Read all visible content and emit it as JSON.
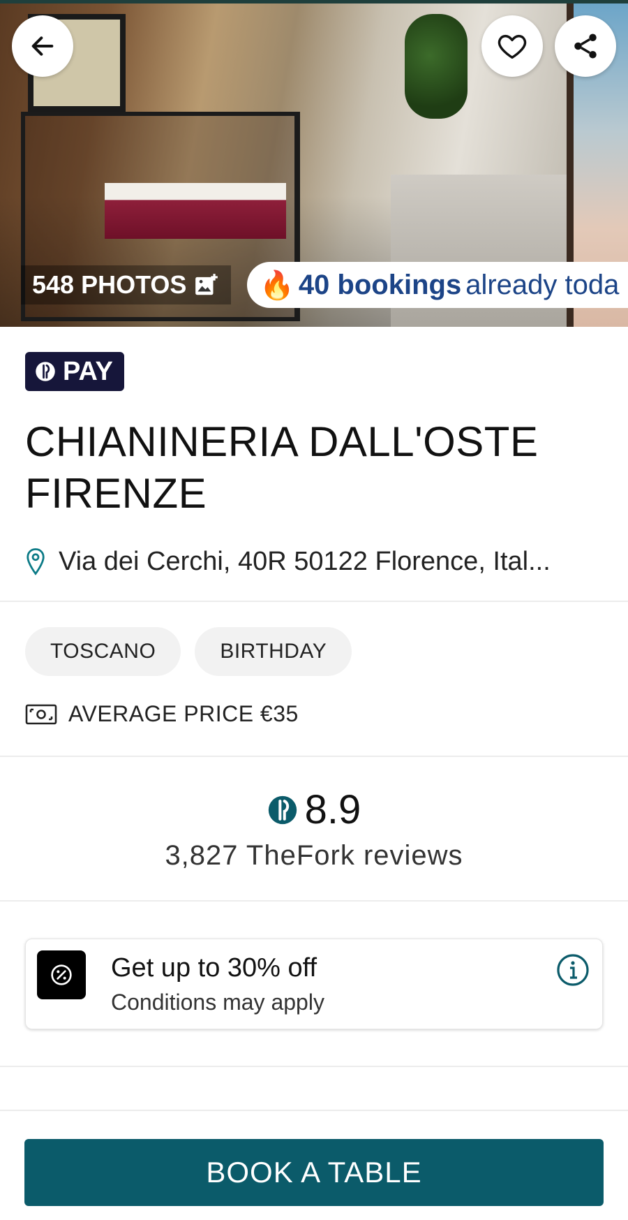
{
  "hero": {
    "photos_label": "548 PHOTOS",
    "bookings_strong": "40 bookings",
    "bookings_rest": "already toda",
    "fire_emoji": "🔥"
  },
  "badge": {
    "pay_label": "PAY"
  },
  "restaurant": {
    "name": "CHIANINERIA DALL'OSTE FIRENZE",
    "address": "Via dei Cerchi, 40R 50122 Florence, Ital..."
  },
  "tags": [
    "TOSCANO",
    "BIRTHDAY"
  ],
  "price": {
    "label": "AVERAGE PRICE €35"
  },
  "rating": {
    "score": "8.9",
    "reviews": "3,827 TheFork reviews"
  },
  "offer": {
    "title": "Get up to 30% off",
    "subtitle": "Conditions may apply"
  },
  "cta": {
    "label": "BOOK A TABLE"
  },
  "colors": {
    "brand_teal": "#0b5b6a",
    "pay_badge_bg": "#16163a",
    "bookings_blue": "#1c4487"
  },
  "icons": {
    "back": "arrow-left-icon",
    "favorite": "heart-icon",
    "share": "share-icon",
    "photos": "add-photo-icon",
    "pay": "thefork-logo-icon",
    "location": "location-pin-icon",
    "price": "banknote-icon",
    "rating": "thefork-logo-icon",
    "offer": "percent-icon",
    "info": "info-icon"
  }
}
